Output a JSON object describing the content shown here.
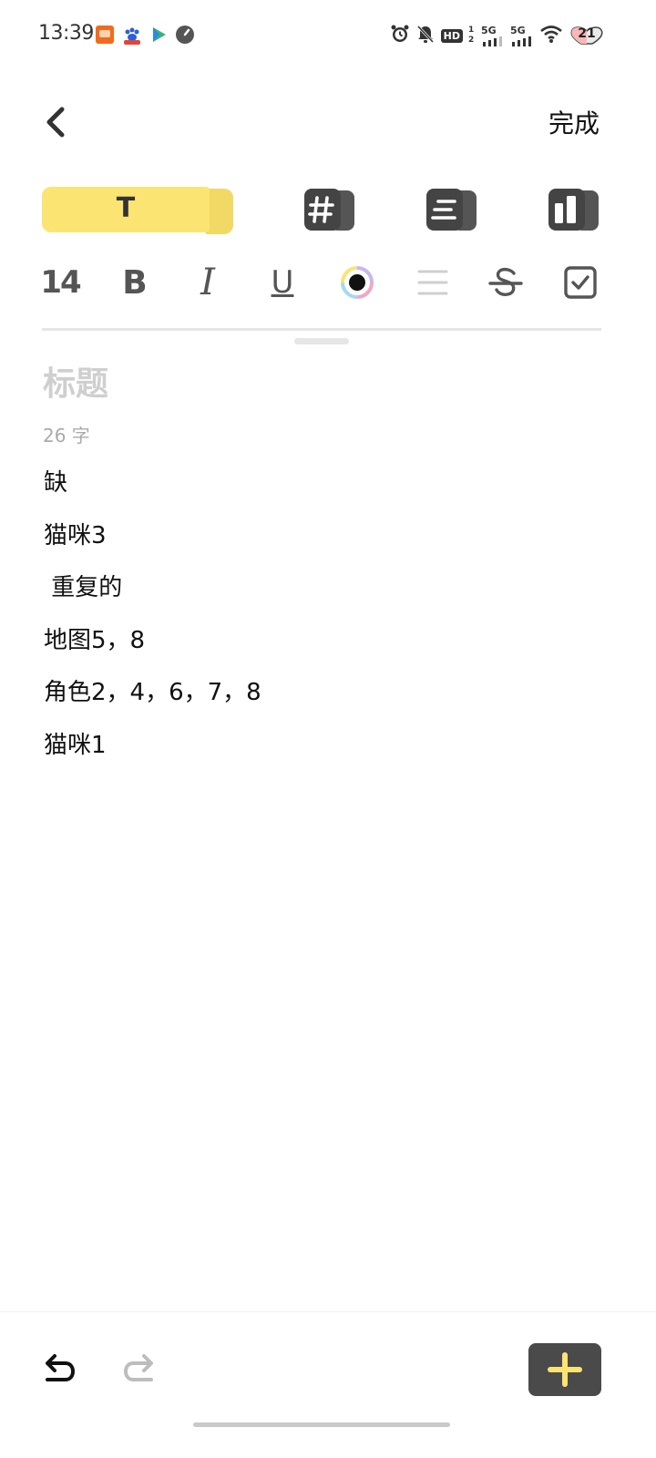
{
  "status_bar": {
    "time": "13:39",
    "app_icons": [
      "app-orange-icon",
      "baidu-paw-icon",
      "play-icon",
      "gauge-icon"
    ],
    "network_1": "5G",
    "network_2": "5G",
    "hd_label": "HD",
    "sim_label": "1 2",
    "battery": "21",
    "colors": {
      "orange": "#f26b1d",
      "blue": "#2d5fd6",
      "green": "#36b37e",
      "gray": "#555555"
    }
  },
  "header": {
    "done_label": "完成"
  },
  "toolbar": {
    "mode_text_label": "T",
    "modes": [
      "text-mode",
      "tag-block-icon",
      "list-block-icon",
      "layout-block-icon"
    ],
    "font_size": "14",
    "bold_label": "B",
    "italic_label": "I",
    "underline_label": "U",
    "accent_color": "#fce473"
  },
  "note": {
    "title_placeholder": "标题",
    "word_count": "26 字",
    "lines": [
      "缺",
      "猫咪3",
      " 重复的",
      "地图5，8",
      "角色2，4，6，7，8",
      "猫咪1"
    ]
  }
}
